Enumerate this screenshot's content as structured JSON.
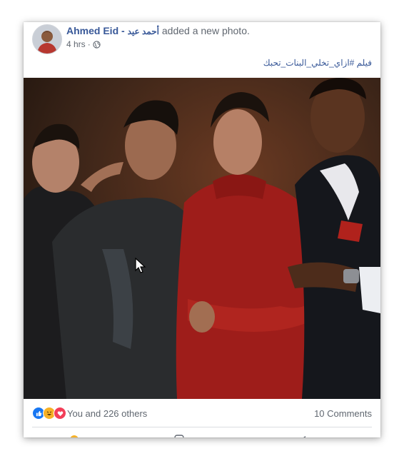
{
  "post": {
    "author": "Ahmed Eid",
    "author_separator": " - ",
    "author_arabic": "أحمد عيد",
    "action_text": " added a new photo.",
    "time": "4 hrs",
    "time_separator": " · ",
    "privacy_icon": "globe-icon",
    "caption": "فيلم #ازاي_تخلي_البنات_تحبك"
  },
  "reactions": {
    "icons": [
      "like-icon",
      "haha-icon",
      "love-icon"
    ],
    "summary": "You and 226 others",
    "comments": "10 Comments"
  },
  "colors": {
    "link": "#385898",
    "secondary_text": "#606770",
    "like_blue": "#1877f2",
    "haha_yellow": "#f7b125",
    "love_red": "#f33e58"
  }
}
